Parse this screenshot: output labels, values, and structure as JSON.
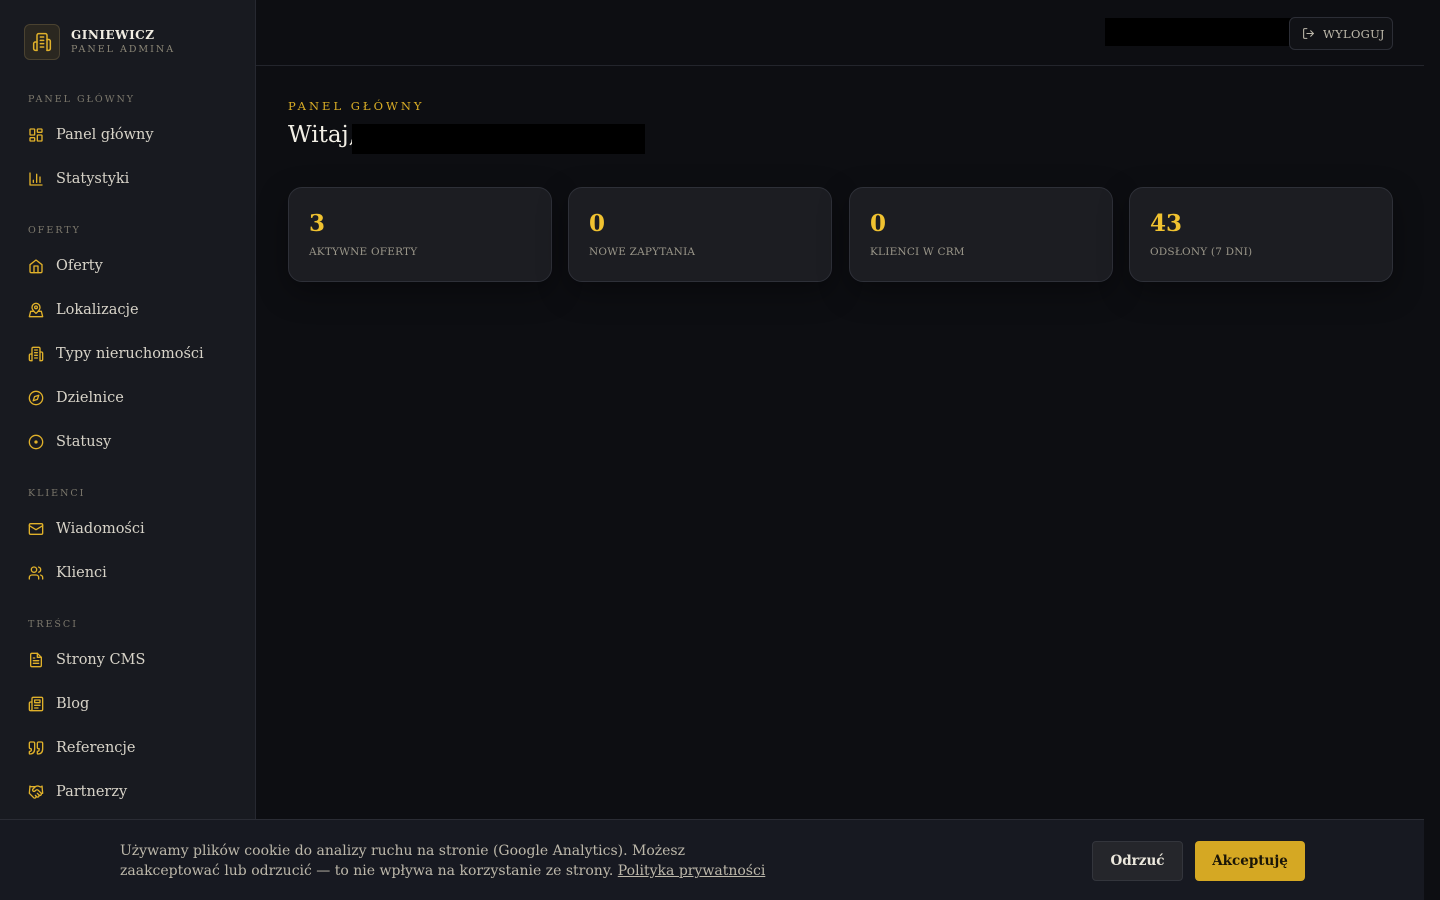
{
  "brand": {
    "name": "GINIEWICZ",
    "subtitle": "PANEL ADMINA",
    "logo_icon": "building-icon"
  },
  "sidebar": {
    "sections": [
      {
        "label": "PANEL GŁÓWNY",
        "items": [
          {
            "label": "Panel główny",
            "icon": "dashboard-grid-icon"
          },
          {
            "label": "Statystyki",
            "icon": "bar-chart-icon"
          }
        ]
      },
      {
        "label": "OFERTY",
        "items": [
          {
            "label": "Oferty",
            "icon": "home-icon"
          },
          {
            "label": "Lokalizacje",
            "icon": "map-pin-icon"
          },
          {
            "label": "Typy nieruchomości",
            "icon": "building-icon"
          },
          {
            "label": "Dzielnice",
            "icon": "compass-icon"
          },
          {
            "label": "Statusy",
            "icon": "circle-dot-icon"
          }
        ]
      },
      {
        "label": "KLIENCI",
        "items": [
          {
            "label": "Wiadomości",
            "icon": "mail-icon"
          },
          {
            "label": "Klienci",
            "icon": "users-icon"
          }
        ]
      },
      {
        "label": "TREŚCI",
        "items": [
          {
            "label": "Strony CMS",
            "icon": "file-text-icon"
          },
          {
            "label": "Blog",
            "icon": "newspaper-icon"
          },
          {
            "label": "Referencje",
            "icon": "quote-icon"
          },
          {
            "label": "Partnerzy",
            "icon": "handshake-icon"
          }
        ]
      }
    ]
  },
  "header": {
    "logout_label": "WYLOGUJ"
  },
  "main": {
    "eyebrow": "PANEL GŁÓWNY",
    "greeting": "Witaj,",
    "stats": [
      {
        "value": "3",
        "label": "AKTYWNE OFERTY"
      },
      {
        "value": "0",
        "label": "NOWE ZAPYTANIA"
      },
      {
        "value": "0",
        "label": "KLIENCI W CRM"
      },
      {
        "value": "43",
        "label": "ODSŁONY (7 DNI)"
      }
    ]
  },
  "cookie": {
    "text": "Używamy plików cookie do analizy ruchu na stronie (Google Analytics). Możesz zaakceptować lub odrzucić — to nie wpływa na korzystanie ze strony.",
    "link_label": "Polityka prywatności",
    "reject_label": "Odrzuć",
    "accept_label": "Akceptuję"
  },
  "colors": {
    "accent": "#d5a823",
    "background": "#0d0e12",
    "sidebar": "#181a20"
  }
}
